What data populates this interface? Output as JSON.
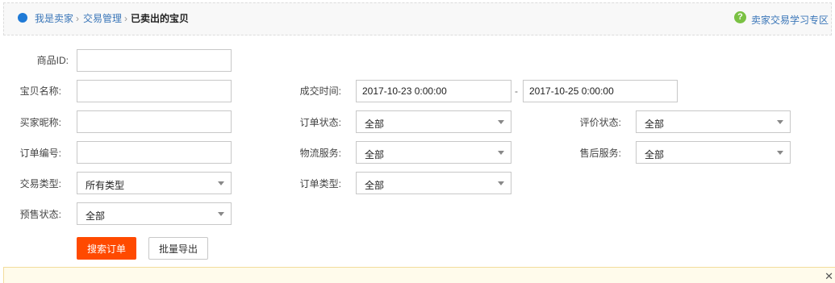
{
  "breadcrumb": {
    "items": [
      {
        "label": "我是卖家"
      },
      {
        "label": "交易管理"
      }
    ],
    "separator": "›",
    "current": "已卖出的宝贝"
  },
  "help": {
    "icon": "?",
    "label": "卖家交易学习专区"
  },
  "form": {
    "item_id": {
      "label": "商品ID:",
      "value": ""
    },
    "item_name": {
      "label": "宝贝名称:",
      "value": ""
    },
    "buyer_nick": {
      "label": "买家昵称:",
      "value": ""
    },
    "order_no": {
      "label": "订单编号:",
      "value": ""
    },
    "deal_type": {
      "label": "交易类型:",
      "value": "所有类型"
    },
    "presale_status": {
      "label": "预售状态:",
      "value": "全部"
    },
    "deal_time": {
      "label": "成交时间:",
      "start": "2017-10-23 0:00:00",
      "separator": "-",
      "end": "2017-10-25 0:00:00"
    },
    "order_status": {
      "label": "订单状态:",
      "value": "全部"
    },
    "logistics": {
      "label": "物流服务:",
      "value": "全部"
    },
    "order_type": {
      "label": "订单类型:",
      "value": "全部"
    },
    "review_status": {
      "label": "评价状态:",
      "value": "全部"
    },
    "after_sale": {
      "label": "售后服务:",
      "value": "全部"
    }
  },
  "actions": {
    "search_label": "搜索订单",
    "export_label": "批量导出"
  },
  "notice": {
    "close_glyph": "✕"
  },
  "colors": {
    "accent": "#ff4a00",
    "link": "#3a76b8",
    "breadcrumb_dot": "#1f7ad6",
    "help_icon": "#7ac143"
  }
}
